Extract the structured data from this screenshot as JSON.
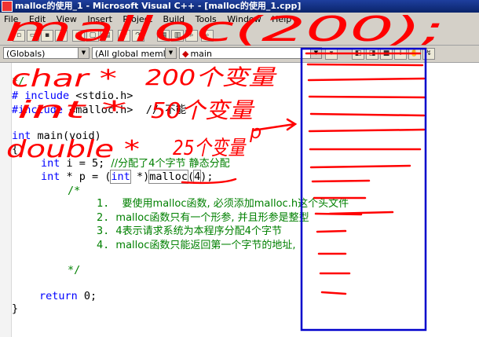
{
  "window": {
    "title": "malloc的使用_1 - Microsoft Visual C++ - [malloc的使用_1.cpp]"
  },
  "menu": [
    "File",
    "Edit",
    "View",
    "Insert",
    "Project",
    "Build",
    "Tools",
    "Window",
    "Help"
  ],
  "toolbar": {
    "scope_combo": "(Globals)",
    "members_combo": "(All global meml",
    "function_combo": "main"
  },
  "code": {
    "l1": "*/",
    "l2_kw": "# include",
    "l2_rest": " <stdio.h>",
    "l3_kw": "#include",
    "l3_rest": " <malloc.h>  // 不能",
    "l4_kw": "int",
    "l4_rest": " main(void)",
    "l5": "{",
    "l6_kw": "int",
    "l6_rest": " i = 5; ",
    "l6_cm": "//分配了4个字节 静态分配",
    "l7_kw": "int",
    "l7_a": " * p = (",
    "l7_kw2": "int",
    "l7_b": " *)",
    "l7_fn": "malloc",
    "l7_c": "(",
    "l7_num": "4",
    "l7_d": ");",
    "l8": "/*",
    "c1_num": "1.",
    "c1_text": "要使用malloc函数, 必须添加malloc.h这个头文件",
    "c2_num": "2.",
    "c2_text": "malloc函数只有一个形参, 并且形参是整型",
    "c3_num": "3.",
    "c3_text": "4表示请求系统为本程序分配4个字节",
    "c4_num": "4.",
    "c4_text": "malloc函数只能返回第一个字节的地址,",
    "c_end": "*/",
    "ret_kw": "return",
    "ret_rest": " 0;",
    "close": "}"
  },
  "annotations": {
    "top": "malloc(200);",
    "char_line": "char *",
    "char_val": "200个变量",
    "int_line": "int *",
    "int_val": "50个变量",
    "double_line": "double *",
    "double_val": "25个变量",
    "pointer": "p",
    "colors": {
      "ink": "#ff0000",
      "box": "#0000cc"
    }
  }
}
